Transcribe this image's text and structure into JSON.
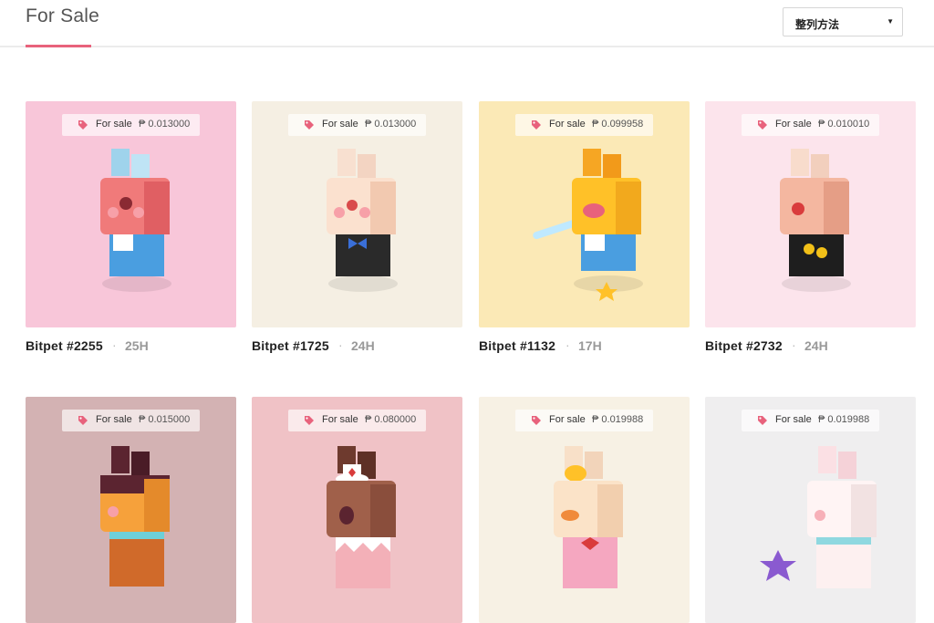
{
  "header": {
    "title": "For Sale",
    "sort_label": "整列方法",
    "sort_caret": "▼"
  },
  "colors": {
    "accent": "#e8627c"
  },
  "cards": [
    {
      "name": "Bitpet #2255",
      "age": "25H",
      "sale_label": "For sale",
      "price": "₱ 0.013000",
      "bg": "#f8c6d9",
      "tag_icon": "price-tag-icon"
    },
    {
      "name": "Bitpet #1725",
      "age": "24H",
      "sale_label": "For sale",
      "price": "₱ 0.013000",
      "bg": "#f5efe3",
      "tag_icon": "price-tag-icon"
    },
    {
      "name": "Bitpet #1132",
      "age": "17H",
      "sale_label": "For sale",
      "price": "₱ 0.099958",
      "bg": "#fbe9b6",
      "tag_icon": "price-tag-icon"
    },
    {
      "name": "Bitpet #2732",
      "age": "24H",
      "sale_label": "For sale",
      "price": "₱ 0.010010",
      "bg": "#fce4ec",
      "tag_icon": "price-tag-icon"
    },
    {
      "sale_label": "For sale",
      "price": "₱ 0.015000",
      "bg": "#d3b2b3",
      "tag_icon": "price-tag-icon"
    },
    {
      "sale_label": "For sale",
      "price": "₱ 0.080000",
      "bg": "#f0c2c6",
      "tag_icon": "price-tag-icon"
    },
    {
      "sale_label": "For sale",
      "price": "₱ 0.019988",
      "bg": "#f7f1e4",
      "tag_icon": "price-tag-icon"
    },
    {
      "sale_label": "For sale",
      "price": "₱ 0.019988",
      "bg": "#efeeef",
      "tag_icon": "price-tag-icon"
    }
  ]
}
